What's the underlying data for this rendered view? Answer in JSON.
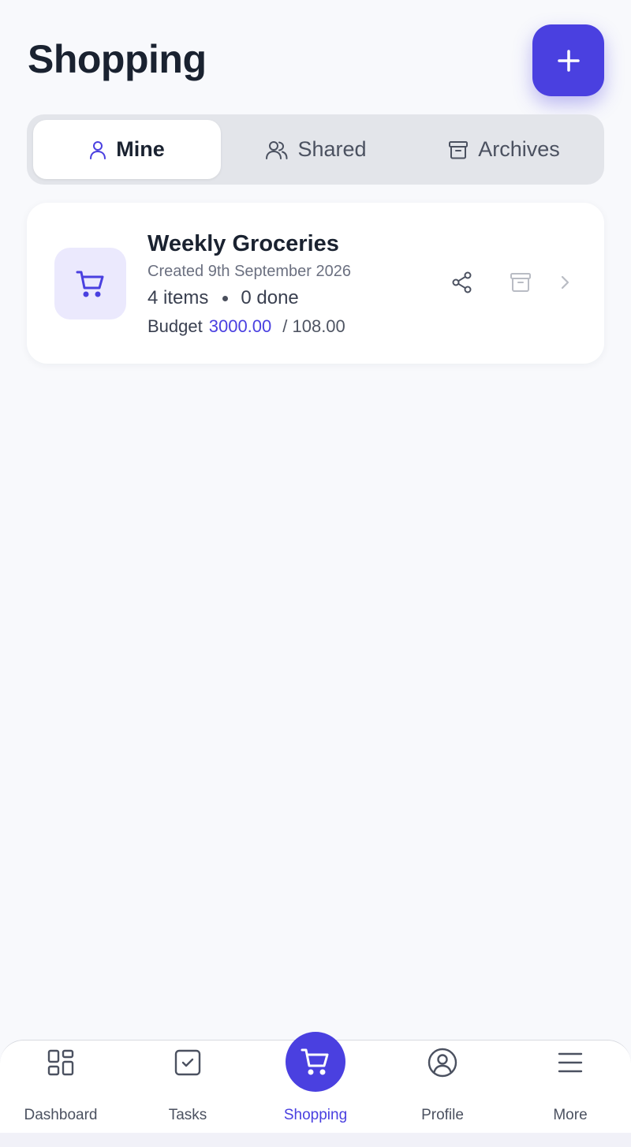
{
  "header": {
    "title": "Shopping"
  },
  "tabs": [
    {
      "label": "Mine",
      "icon": "user-icon",
      "active": true
    },
    {
      "label": "Shared",
      "icon": "users-icon",
      "active": false
    },
    {
      "label": "Archives",
      "icon": "archive-icon",
      "active": false
    }
  ],
  "lists": [
    {
      "title": "Weekly Groceries",
      "created": "Created 9th September 2026",
      "items": "4 items",
      "done": "0 done",
      "budget_label": "Budget",
      "budget": "3000.00",
      "spent": "/ 108.00",
      "icon": "cart-icon"
    }
  ],
  "nav": [
    {
      "label": "Dashboard",
      "icon": "grid-icon",
      "active": false
    },
    {
      "label": "Tasks",
      "icon": "checkbox-icon",
      "active": false
    },
    {
      "label": "Shopping",
      "icon": "cart-icon",
      "active": true
    },
    {
      "label": "Profile",
      "icon": "user-circle-icon",
      "active": false
    },
    {
      "label": "More",
      "icon": "menu-icon",
      "active": false
    }
  ],
  "colors": {
    "accent": "#4a40e0",
    "accent_soft": "#ebe9fd",
    "background": "#f8f9fc",
    "text": "#1a2230"
  }
}
